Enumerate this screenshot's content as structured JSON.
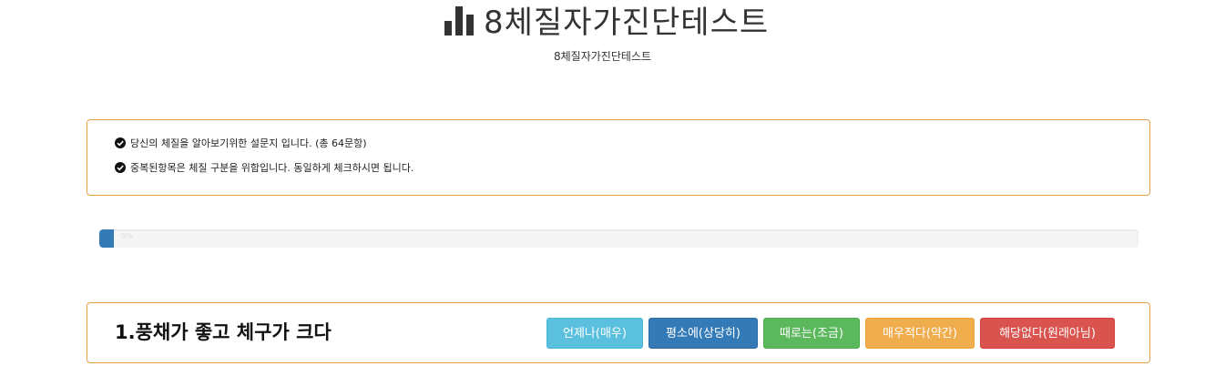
{
  "header": {
    "title": "8체질자가진단테스트",
    "subtitle": "8체질자가진단테스트",
    "title_icon": "bar-chart-icon"
  },
  "notice": {
    "items": [
      {
        "icon": "check-circle-icon",
        "text": "당신의 체질을 알아보기위한 설문지 입니다. (총 64문항)"
      },
      {
        "icon": "check-circle-icon",
        "text": "중복된항목은 체질 구분을 위함입니다. 동일하게 체크하시면 됩니다."
      }
    ]
  },
  "progress": {
    "fraction": 0.014,
    "label": "0%"
  },
  "question": {
    "text": "1.풍채가 좋고 체구가 크다",
    "options": [
      {
        "label": "언제나(매우)",
        "color": "#5bc0de"
      },
      {
        "label": "평소에(상당히)",
        "color": "#337ab7"
      },
      {
        "label": "때로는(조금)",
        "color": "#5cb85c"
      },
      {
        "label": "매우적다(약간)",
        "color": "#f0ad4e"
      },
      {
        "label": "해당없다(원래아님)",
        "color": "#d9534f"
      }
    ]
  },
  "colors": {
    "panel_border": "#e8a045",
    "progress_bar": "#337ab7"
  }
}
